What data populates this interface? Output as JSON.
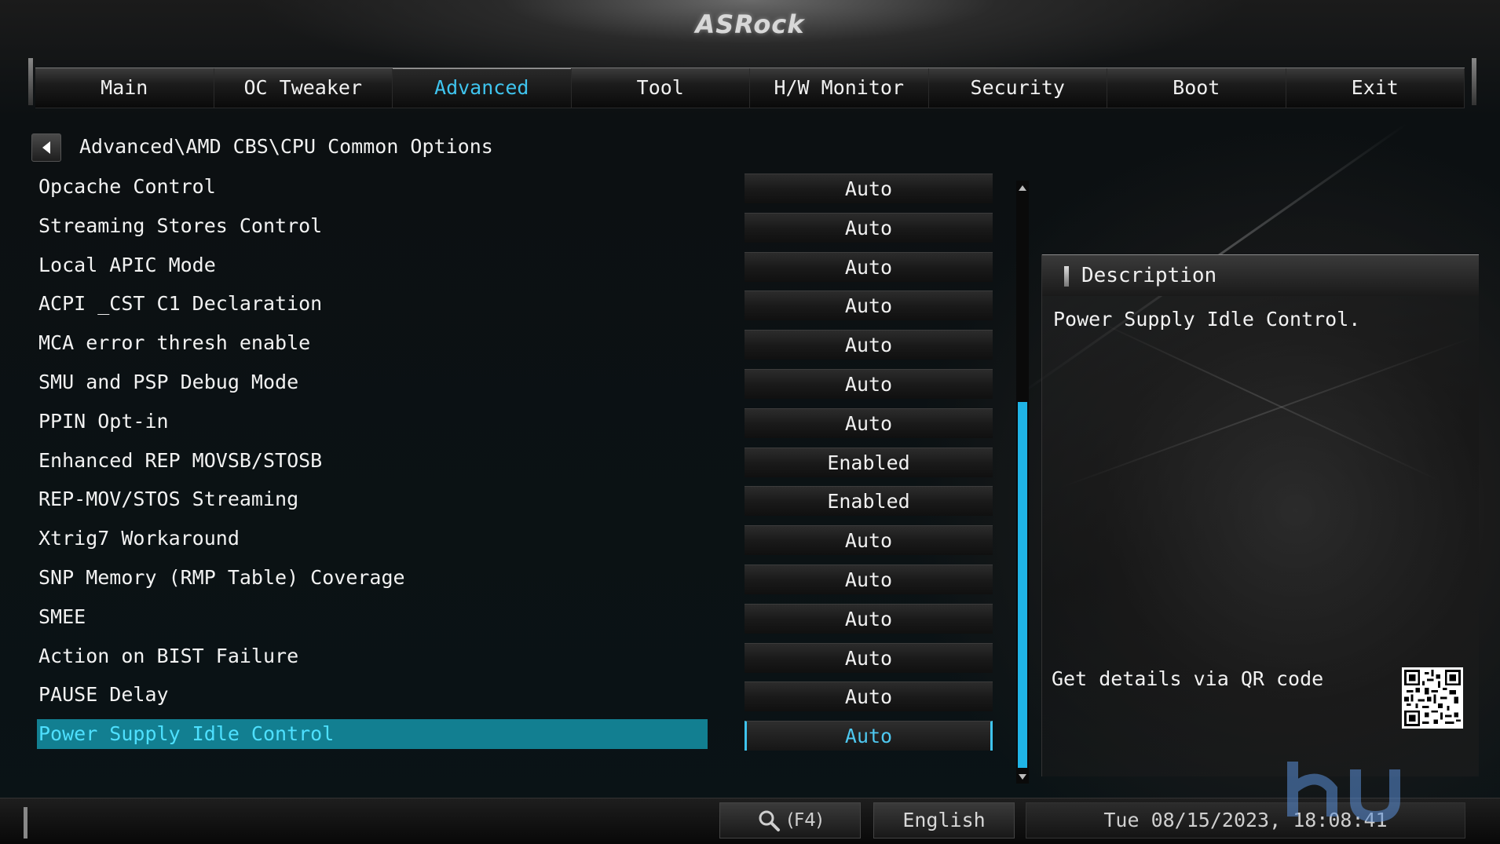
{
  "brand": {
    "logo_text": "ASRock"
  },
  "tabs": [
    {
      "label": "Main",
      "active": false
    },
    {
      "label": "OC Tweaker",
      "active": false
    },
    {
      "label": "Advanced",
      "active": true
    },
    {
      "label": "Tool",
      "active": false
    },
    {
      "label": "H/W Monitor",
      "active": false
    },
    {
      "label": "Security",
      "active": false
    },
    {
      "label": "Boot",
      "active": false
    },
    {
      "label": "Exit",
      "active": false
    }
  ],
  "breadcrumb": {
    "path": "Advanced\\AMD CBS\\CPU Common Options"
  },
  "settings": [
    {
      "label": "Opcache Control",
      "value": "Auto"
    },
    {
      "label": "Streaming Stores Control",
      "value": "Auto"
    },
    {
      "label": "Local APIC Mode",
      "value": "Auto"
    },
    {
      "label": "ACPI _CST C1 Declaration",
      "value": "Auto"
    },
    {
      "label": "MCA error thresh enable",
      "value": "Auto"
    },
    {
      "label": "SMU and PSP Debug Mode",
      "value": "Auto"
    },
    {
      "label": "PPIN Opt-in",
      "value": "Auto"
    },
    {
      "label": "Enhanced REP MOVSB/STOSB",
      "value": "Enabled"
    },
    {
      "label": "REP-MOV/STOS Streaming",
      "value": "Enabled"
    },
    {
      "label": "Xtrig7 Workaround",
      "value": "Auto"
    },
    {
      "label": "SNP Memory (RMP Table) Coverage",
      "value": "Auto"
    },
    {
      "label": "SMEE",
      "value": "Auto"
    },
    {
      "label": "Action on BIST Failure",
      "value": "Auto"
    },
    {
      "label": "PAUSE Delay",
      "value": "Auto"
    },
    {
      "label": "Power Supply Idle Control",
      "value": "Auto",
      "selected": true
    }
  ],
  "description": {
    "title": "Description",
    "text": "Power Supply Idle Control.",
    "qr_label": "Get details via QR code"
  },
  "footer": {
    "search_label": "(F4)",
    "language": "English",
    "datetime": "Tue 08/15/2023, 18:08:41"
  },
  "colors": {
    "accent": "#3fc4ee",
    "selected_row_bg": "#127f91",
    "scroll_thumb": "#1fb4e6"
  },
  "icons": {
    "back": "chevron-left-icon",
    "search": "magnifier-icon",
    "scroll_up": "triangle-up-icon",
    "scroll_down": "triangle-down-icon"
  }
}
